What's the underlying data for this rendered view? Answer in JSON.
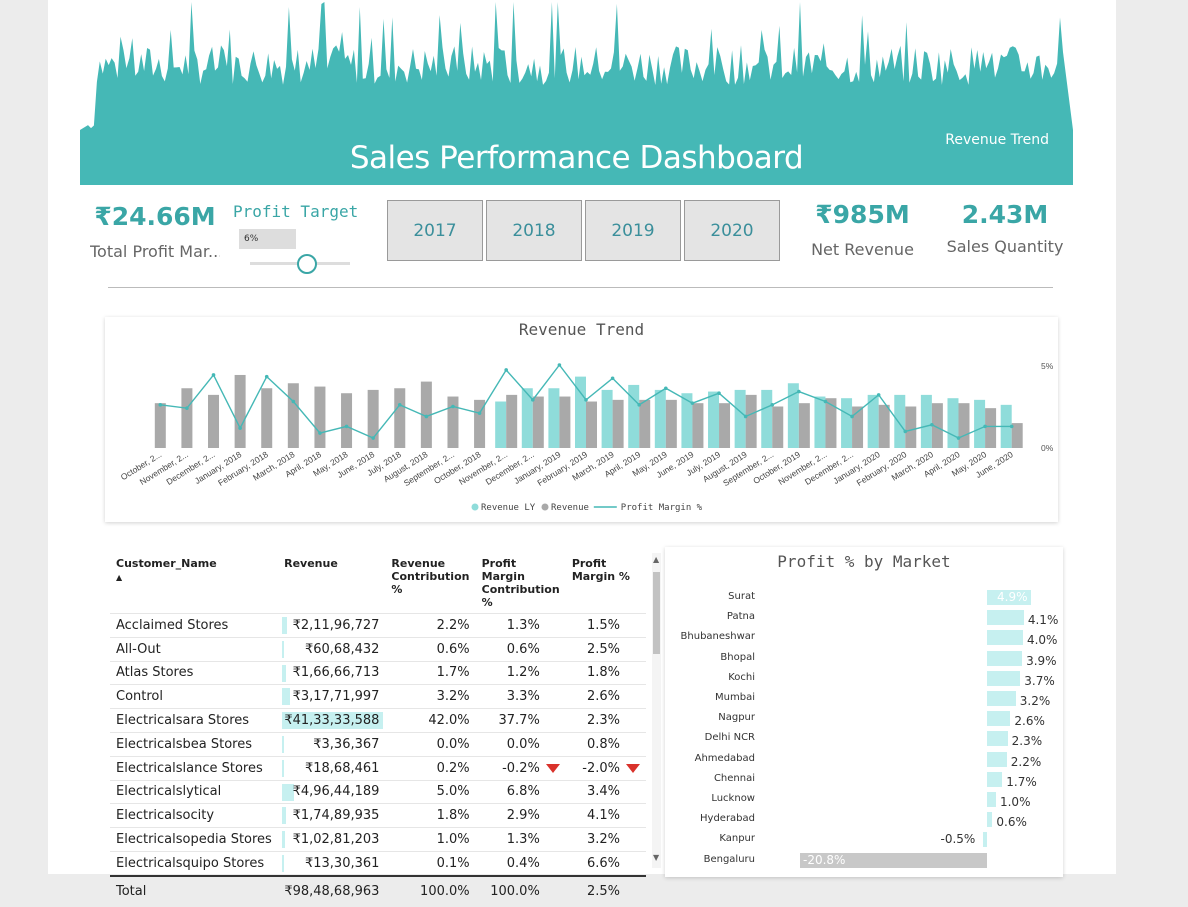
{
  "header": {
    "title": "Sales Performance Dashboard",
    "subtitle": "Revenue Trend"
  },
  "kpis": {
    "total_profit": {
      "value": "₹24.66M",
      "label": "Total Profit Mar..."
    },
    "net_revenue": {
      "value": "₹985M",
      "label": "Net Revenue"
    },
    "sales_quantity": {
      "value": "2.43M",
      "label": "Sales Quantity"
    }
  },
  "profit_target": {
    "label": "Profit Target",
    "value": "6%",
    "level": 0.55
  },
  "years": [
    "2017",
    "2018",
    "2019",
    "2020"
  ],
  "colors": {
    "teal": "#45b8b6",
    "teal_light": "#8fdcda",
    "gray": "#a9a9a9",
    "bar_light": "#c6f0f0",
    "down": "#d9322b"
  },
  "chart_data": [
    {
      "type": "bar",
      "title": "Revenue Trend",
      "categories": [
        "October, 2...",
        "November, 2...",
        "December, 2...",
        "January, 2018",
        "February, 2018",
        "March, 2018",
        "April, 2018",
        "May, 2018",
        "June, 2018",
        "July, 2018",
        "August, 2018",
        "September, 2...",
        "October, 2018",
        "November, 2...",
        "December, 2...",
        "January, 2019",
        "February, 2019",
        "March, 2019",
        "April, 2019",
        "May, 2019",
        "June, 2019",
        "July, 2019",
        "August, 2019",
        "September, 2...",
        "October, 2019",
        "November, 2...",
        "December, 2...",
        "January, 2020",
        "February, 2020",
        "March, 2020",
        "April, 2020",
        "May, 2020",
        "June, 2020"
      ],
      "series": [
        {
          "name": "Revenue LY",
          "values": [
            0,
            0,
            0,
            0,
            0,
            0,
            0,
            0,
            0,
            0,
            0,
            0,
            0,
            28,
            36,
            36,
            43,
            35,
            38,
            35,
            33,
            34,
            35,
            35,
            39,
            31,
            30,
            32,
            32,
            32,
            30,
            29,
            26
          ]
        },
        {
          "name": "Revenue",
          "values": [
            27,
            36,
            32,
            44,
            36,
            39,
            37,
            33,
            35,
            36,
            40,
            31,
            29,
            32,
            31,
            31,
            28,
            29,
            29,
            29,
            27,
            27,
            32,
            25,
            27,
            30,
            25,
            26,
            25,
            27,
            27,
            24,
            15
          ]
        },
        {
          "name": "Profit Margin %",
          "values": [
            2.6,
            2.4,
            4.4,
            1.2,
            4.3,
            2.8,
            0.9,
            1.3,
            0.6,
            2.6,
            1.9,
            2.5,
            2.1,
            4.7,
            2.9,
            5.0,
            2.9,
            4.2,
            2.6,
            3.6,
            2.7,
            3.3,
            1.9,
            2.6,
            3.4,
            2.8,
            1.9,
            3.2,
            1.0,
            1.4,
            0.6,
            1.3,
            1.3
          ]
        }
      ],
      "y2_ticks": [
        "5%",
        "0%"
      ],
      "legend": [
        "Revenue LY",
        "Revenue",
        "Profit Margin %"
      ],
      "legend_position": "bottom"
    },
    {
      "type": "bar",
      "title": "Profit % by Market",
      "categories": [
        "Surat",
        "Patna",
        "Bhubaneshwar",
        "Bhopal",
        "Kochi",
        "Mumbai",
        "Nagpur",
        "Delhi NCR",
        "Ahmedabad",
        "Chennai",
        "Lucknow",
        "Hyderabad",
        "Kanpur",
        "Bengaluru"
      ],
      "values": [
        4.9,
        4.1,
        4.0,
        3.9,
        3.7,
        3.2,
        2.6,
        2.3,
        2.2,
        1.7,
        1.0,
        0.6,
        -0.5,
        -20.8
      ],
      "labels": [
        "4.9%",
        "4.1%",
        "4.0%",
        "3.9%",
        "3.7%",
        "3.2%",
        "2.6%",
        "2.3%",
        "2.2%",
        "1.7%",
        "1.0%",
        "0.6%",
        "-0.5%",
        "-20.8%"
      ]
    }
  ],
  "table": {
    "columns": [
      "Customer_Name",
      "Revenue",
      "Revenue Contribution %",
      "Profit Margin Contribution %",
      "Profit Margin %"
    ],
    "sort_indicator": "▲",
    "rows": [
      {
        "name": "Acclaimed Stores",
        "revenue": "₹2,11,96,727",
        "rev_pct": "2.2%",
        "pm_contrib": "1.3%",
        "pm": "1.5%",
        "share": 0.022
      },
      {
        "name": "All-Out",
        "revenue": "₹60,68,432",
        "rev_pct": "0.6%",
        "pm_contrib": "0.6%",
        "pm": "2.5%",
        "share": 0.006
      },
      {
        "name": "Atlas Stores",
        "revenue": "₹1,66,66,713",
        "rev_pct": "1.7%",
        "pm_contrib": "1.2%",
        "pm": "1.8%",
        "share": 0.017
      },
      {
        "name": "Control",
        "revenue": "₹3,17,71,997",
        "rev_pct": "3.2%",
        "pm_contrib": "3.3%",
        "pm": "2.6%",
        "share": 0.032
      },
      {
        "name": "Electricalsara Stores",
        "revenue": "₹41,33,33,588",
        "rev_pct": "42.0%",
        "pm_contrib": "37.7%",
        "pm": "2.3%",
        "share": 0.42
      },
      {
        "name": "Electricalsbea Stores",
        "revenue": "₹3,36,367",
        "rev_pct": "0.0%",
        "pm_contrib": "0.0%",
        "pm": "0.8%",
        "share": 0.0
      },
      {
        "name": "Electricalslance Stores",
        "revenue": "₹18,68,461",
        "rev_pct": "0.2%",
        "pm_contrib": "-0.2%",
        "pm": "-2.0%",
        "share": 0.002,
        "negative": true
      },
      {
        "name": "Electricalslytical",
        "revenue": "₹4,96,44,189",
        "rev_pct": "5.0%",
        "pm_contrib": "6.8%",
        "pm": "3.4%",
        "share": 0.05
      },
      {
        "name": "Electricalsocity",
        "revenue": "₹1,74,89,935",
        "rev_pct": "1.8%",
        "pm_contrib": "2.9%",
        "pm": "4.1%",
        "share": 0.018
      },
      {
        "name": "Electricalsopedia Stores",
        "revenue": "₹1,02,81,203",
        "rev_pct": "1.0%",
        "pm_contrib": "1.3%",
        "pm": "3.2%",
        "share": 0.01
      },
      {
        "name": "Electricalsquipo Stores",
        "revenue": "₹13,30,361",
        "rev_pct": "0.1%",
        "pm_contrib": "0.4%",
        "pm": "6.6%",
        "share": 0.001
      }
    ],
    "total": {
      "name": "Total",
      "revenue": "₹98,48,68,963",
      "rev_pct": "100.0%",
      "pm_contrib": "100.0%",
      "pm": "2.5%"
    }
  }
}
